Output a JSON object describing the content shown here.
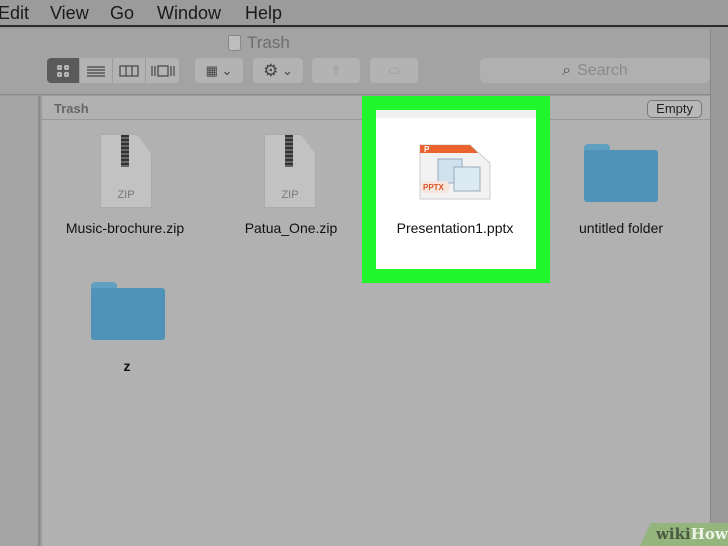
{
  "menubar": {
    "items": [
      "Edit",
      "View",
      "Go",
      "Window",
      "Help"
    ]
  },
  "window": {
    "title": "Trash"
  },
  "toolbar": {
    "view_modes": [
      "icon-view",
      "list-view",
      "column-view",
      "cover-flow-view"
    ],
    "active_view": "icon-view",
    "search_placeholder": "Search"
  },
  "pathbar": {
    "title": "Trash",
    "empty_button": "Empty"
  },
  "files": [
    {
      "name": "Music-brochure.zip",
      "type": "zip",
      "badge": "ZIP"
    },
    {
      "name": "Patua_One.zip",
      "type": "zip",
      "badge": "ZIP"
    },
    {
      "name": "Presentation1.pptx",
      "type": "pptx",
      "badge": "PPTX",
      "selected": true
    },
    {
      "name": "untitled folder",
      "type": "folder"
    },
    {
      "name": "z",
      "type": "folder"
    }
  ],
  "highlight_color": "#21f52b",
  "watermark": {
    "a": "wiki",
    "b": "How"
  }
}
